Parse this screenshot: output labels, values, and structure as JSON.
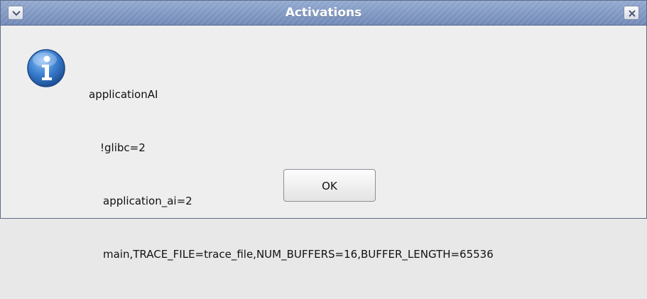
{
  "window": {
    "title": "Activations"
  },
  "message": {
    "lines": [
      "applicationAI",
      "!glibc=2",
      "application_ai=2",
      "main,TRACE_FILE=trace_file,NUM_BUFFERS=16,BUFFER_LENGTH=65536"
    ]
  },
  "buttons": {
    "ok_label": "OK"
  },
  "icons": {
    "window_menu": "chevron-down-icon",
    "close": "close-icon",
    "message_type": "info-icon"
  },
  "colors": {
    "titlebar": "#7f96c2",
    "info_icon": "#2f6fc0"
  }
}
